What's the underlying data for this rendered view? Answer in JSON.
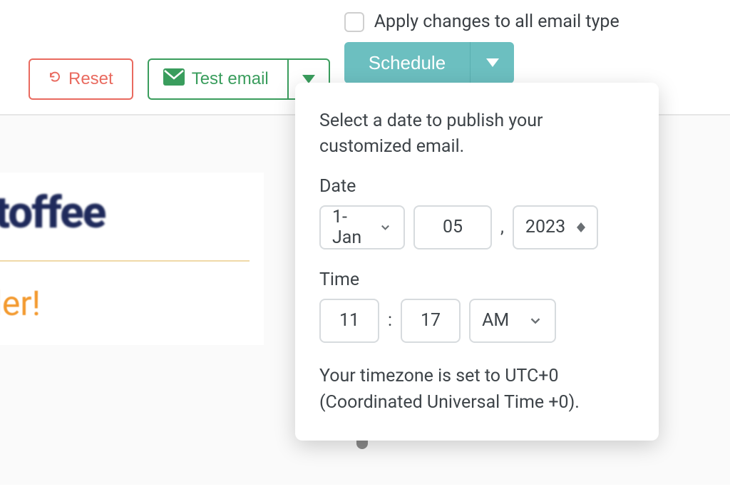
{
  "toolbar": {
    "reset_label": "Reset",
    "test_email_label": "Test email",
    "schedule_label": "Schedule"
  },
  "apply": {
    "label": "Apply changes to all email type"
  },
  "popover": {
    "intro": "Select a date to publish your customized email.",
    "date_label": "Date",
    "time_label": "Time",
    "month_value": "1-Jan",
    "day_value": "05",
    "year_value": "2023",
    "hour_value": "11",
    "minute_value": "17",
    "ampm_value": "AM",
    "timezone_text": "Your timezone is set to UTC+0 (Coordinated Universal Time +0)."
  },
  "preview": {
    "brand_fragment": "otoffee",
    "headline_fragment": "rder!"
  }
}
